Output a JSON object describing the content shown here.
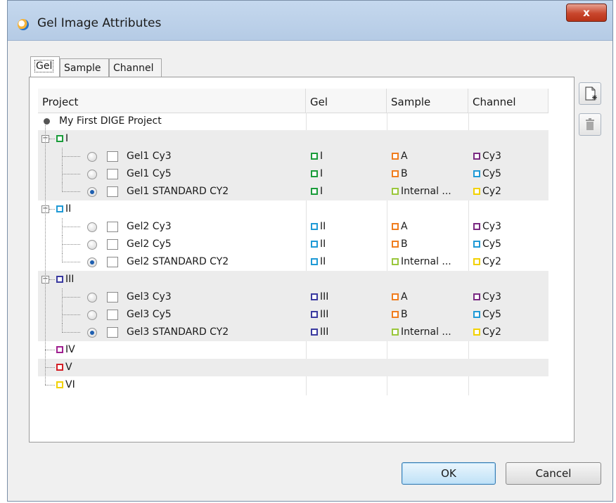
{
  "window": {
    "title": "Gel Image Attributes",
    "close_label": "x"
  },
  "tabs": [
    {
      "label": "Gel",
      "active": true
    },
    {
      "label": "Sample",
      "active": false
    },
    {
      "label": "Channel",
      "active": false
    }
  ],
  "columns": [
    "Project",
    "Gel",
    "Sample",
    "Channel"
  ],
  "root": {
    "label": "My First DIGE Project"
  },
  "colors": {
    "green": "#1a9c3a",
    "cyan": "#1f9ad6",
    "navy": "#3a3aa0",
    "magenta": "#a02090",
    "red": "#d41f26",
    "yellow": "#f2d100",
    "orange": "#f07d1e",
    "lime": "#9ac73c",
    "purple": "#7a2a82",
    "blue": "#1f9ad6"
  },
  "groups": [
    {
      "label": "I",
      "color": "#1a9c3a",
      "expanded": true,
      "children": [
        {
          "name": "Gel1 Cy3",
          "selected": false,
          "gel": "I",
          "gel_color": "#1a9c3a",
          "sample": "A",
          "sample_color": "#f07d1e",
          "channel": "Cy3",
          "channel_color": "#7a2a82"
        },
        {
          "name": "Gel1 Cy5",
          "selected": false,
          "gel": "I",
          "gel_color": "#1a9c3a",
          "sample": "B",
          "sample_color": "#f07d1e",
          "channel": "Cy5",
          "channel_color": "#1f9ad6"
        },
        {
          "name": "Gel1 STANDARD CY2",
          "selected": true,
          "gel": "I",
          "gel_color": "#1a9c3a",
          "sample": "Internal ...",
          "sample_color": "#9ac73c",
          "channel": "Cy2",
          "channel_color": "#f2d100"
        }
      ]
    },
    {
      "label": "II",
      "color": "#1f9ad6",
      "expanded": true,
      "children": [
        {
          "name": "Gel2 Cy3",
          "selected": false,
          "gel": "II",
          "gel_color": "#1f9ad6",
          "sample": "A",
          "sample_color": "#f07d1e",
          "channel": "Cy3",
          "channel_color": "#7a2a82"
        },
        {
          "name": "Gel2 Cy5",
          "selected": false,
          "gel": "II",
          "gel_color": "#1f9ad6",
          "sample": "B",
          "sample_color": "#f07d1e",
          "channel": "Cy5",
          "channel_color": "#1f9ad6"
        },
        {
          "name": "Gel2 STANDARD CY2",
          "selected": true,
          "gel": "II",
          "gel_color": "#1f9ad6",
          "sample": "Internal ...",
          "sample_color": "#9ac73c",
          "channel": "Cy2",
          "channel_color": "#f2d100"
        }
      ]
    },
    {
      "label": "III",
      "color": "#3a3aa0",
      "expanded": true,
      "children": [
        {
          "name": "Gel3 Cy3",
          "selected": false,
          "gel": "III",
          "gel_color": "#3a3aa0",
          "sample": "A",
          "sample_color": "#f07d1e",
          "channel": "Cy3",
          "channel_color": "#7a2a82"
        },
        {
          "name": "Gel3 Cy5",
          "selected": false,
          "gel": "III",
          "gel_color": "#3a3aa0",
          "sample": "B",
          "sample_color": "#f07d1e",
          "channel": "Cy5",
          "channel_color": "#1f9ad6"
        },
        {
          "name": "Gel3 STANDARD CY2",
          "selected": true,
          "gel": "III",
          "gel_color": "#3a3aa0",
          "sample": "Internal ...",
          "sample_color": "#9ac73c",
          "channel": "Cy2",
          "channel_color": "#f2d100"
        }
      ]
    },
    {
      "label": "IV",
      "color": "#a02090",
      "expanded": false,
      "children": []
    },
    {
      "label": "V",
      "color": "#d41f26",
      "expanded": false,
      "children": []
    },
    {
      "label": "VI",
      "color": "#f2d100",
      "expanded": false,
      "children": []
    }
  ],
  "side_buttons": [
    {
      "icon": "new-document-icon",
      "enabled": true
    },
    {
      "icon": "trash-icon",
      "enabled": false
    }
  ],
  "buttons": {
    "ok": "OK",
    "cancel": "Cancel"
  }
}
